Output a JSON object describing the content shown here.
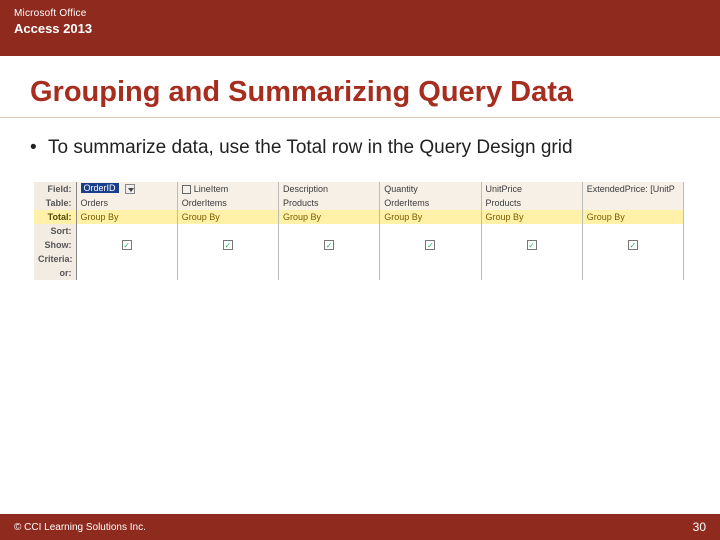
{
  "header": {
    "brand_line1": "Microsoft Office",
    "brand_line2": "Access 2013"
  },
  "title": "Grouping and Summarizing Query Data",
  "bullet": {
    "marker": "•",
    "text": "To summarize data, use the Total row in the Query Design grid"
  },
  "grid": {
    "row_labels": {
      "field": "Field:",
      "table": "Table:",
      "total": "Total:",
      "sort": "Sort:",
      "show": "Show:",
      "criteria": "Criteria:",
      "or": "or:"
    },
    "columns": [
      {
        "field": "OrderID",
        "selected": true,
        "dropdown": true,
        "table": "Orders",
        "total": "Group By",
        "show": true
      },
      {
        "field": "LineItem",
        "field_checkbox": true,
        "table": "OrderItems",
        "total": "Group By",
        "show": true
      },
      {
        "field": "Description",
        "table": "Products",
        "total": "Group By",
        "show": true
      },
      {
        "field": "Quantity",
        "table": "OrderItems",
        "total": "Group By",
        "show": true
      },
      {
        "field": "UnitPrice",
        "table": "Products",
        "total": "Group By",
        "show": true
      },
      {
        "field": "ExtendedPrice: [UnitP",
        "table": "",
        "total": "Group By",
        "show": true
      }
    ],
    "check_glyph": "✓"
  },
  "footer": {
    "copyright": "© CCI Learning Solutions Inc.",
    "page": "30"
  }
}
